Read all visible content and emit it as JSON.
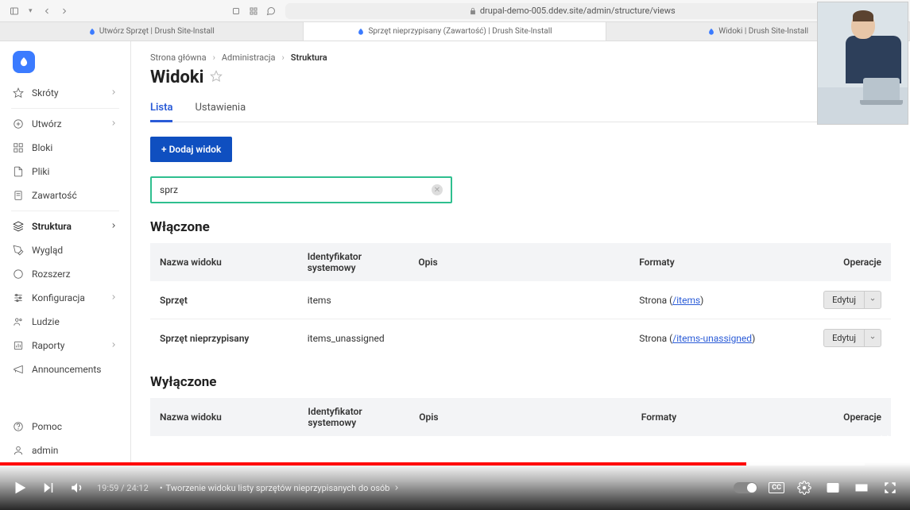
{
  "browser": {
    "url": "drupal-demo-005.ddev.site/admin/structure/views",
    "tabs": [
      {
        "label": "Utwórz Sprzęt | Drush Site-Install"
      },
      {
        "label": "Sprzęt nieprzypisany (Zawartość) | Drush Site-Install"
      },
      {
        "label": "Widoki | Drush Site-Install"
      }
    ],
    "active_tab": 1
  },
  "sidebar": {
    "items": [
      {
        "label": "Skróty",
        "icon": "star",
        "chev": true
      },
      {
        "label": "Utwórz",
        "icon": "plus-circle",
        "chev": true,
        "sep_before": true
      },
      {
        "label": "Bloki",
        "icon": "grid"
      },
      {
        "label": "Pliki",
        "icon": "file"
      },
      {
        "label": "Zawartość",
        "icon": "doc"
      },
      {
        "label": "Struktura",
        "icon": "layers",
        "chev": true,
        "active": true,
        "sep_before": true
      },
      {
        "label": "Wygląd",
        "icon": "brush"
      },
      {
        "label": "Rozszerz",
        "icon": "puzzle"
      },
      {
        "label": "Konfiguracja",
        "icon": "sliders",
        "chev": true
      },
      {
        "label": "Ludzie",
        "icon": "users"
      },
      {
        "label": "Raporty",
        "icon": "report",
        "chev": true
      },
      {
        "label": "Announcements",
        "icon": "megaphone"
      }
    ],
    "footer": [
      {
        "label": "Pomoc",
        "icon": "help"
      },
      {
        "label": "admin",
        "icon": "user"
      }
    ]
  },
  "breadcrumb": [
    "Strona główna",
    "Administracja",
    "Struktura"
  ],
  "page_title": "Widoki",
  "tabs": {
    "list": "Lista",
    "settings": "Ustawienia"
  },
  "buttons": {
    "add": "+ Dodaj widok",
    "edit": "Edytuj"
  },
  "filter": {
    "value": "sprz"
  },
  "sections": {
    "enabled": "Włączone",
    "disabled": "Wyłączone"
  },
  "headers": {
    "name": "Nazwa widoku",
    "id": "Identyfikator systemowy",
    "desc": "Opis",
    "formats": "Formaty",
    "ops": "Operacje"
  },
  "enabled_rows": [
    {
      "name": "Sprzęt",
      "id": "items",
      "desc": "",
      "format_prefix": "Strona (",
      "format_link": "/items",
      "format_suffix": ")"
    },
    {
      "name": "Sprzęt nieprzypisany",
      "id": "items_unassigned",
      "desc": "",
      "format_prefix": "Strona (",
      "format_link": "/items-unassigned",
      "format_suffix": ")"
    }
  ],
  "player": {
    "current": "19:59",
    "total": "24:12",
    "chapter": "Tworzenie widoku listy sprzętów nieprzypisanych do osób",
    "progress_pct": 82,
    "buffer_pct": 95
  }
}
